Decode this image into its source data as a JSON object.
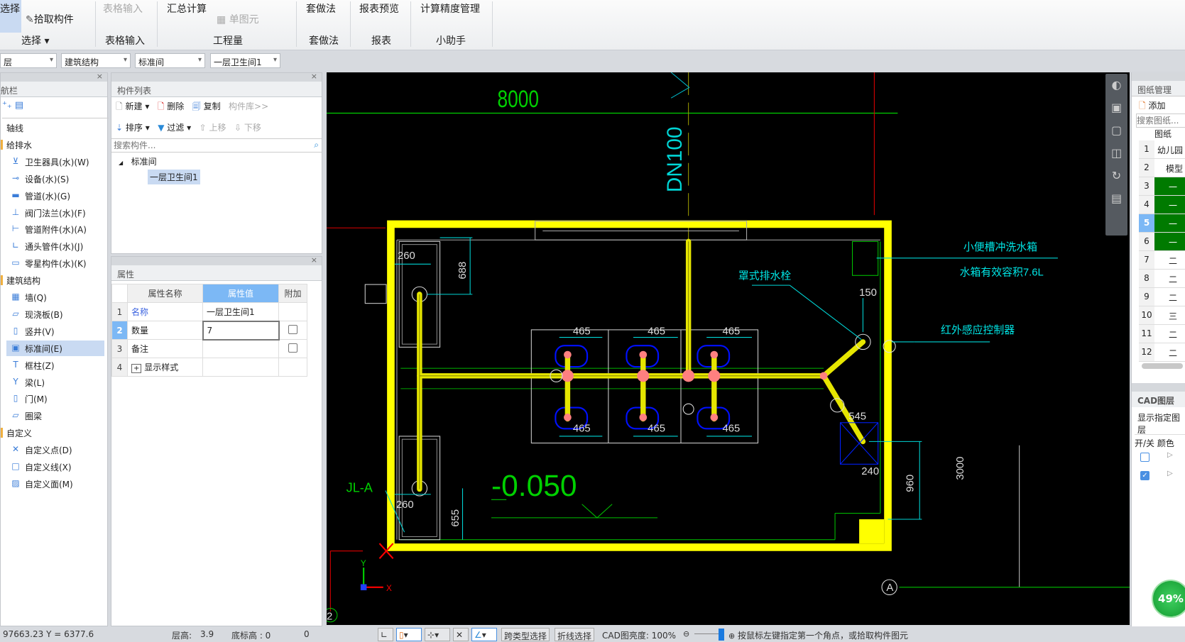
{
  "ribbon": {
    "select_big": "选择",
    "pick": "拾取构件",
    "select_group": "选择 ▾",
    "table_input_btn": "表格输入",
    "table_input_group": "表格输入",
    "summary": "汇总计算",
    "single": "单图元",
    "quantity_group": "工程量",
    "method_btn": "套做法",
    "method_group": "套做法",
    "report_btn": "报表预览",
    "report_group": "报表",
    "precision_btn": "计算精度管理",
    "helper_group": "小助手"
  },
  "toolbar": {
    "floor": "层",
    "major": "建筑结构",
    "type": "标准间",
    "item": "一层卫生间1"
  },
  "nav": {
    "title": "航栏",
    "items": [
      {
        "label": "轴线",
        "group": true
      },
      {
        "label": "给排水",
        "group": true
      },
      {
        "label": "卫生器具(水)(W)",
        "icon": "toilet-icon"
      },
      {
        "label": "设备(水)(S)",
        "icon": "equipment-icon"
      },
      {
        "label": "管道(水)(G)",
        "icon": "pipe-icon"
      },
      {
        "label": "阀门法兰(水)(F)",
        "icon": "valve-icon"
      },
      {
        "label": "管道附件(水)(A)",
        "icon": "pipe-accessory-icon"
      },
      {
        "label": "通头管件(水)(J)",
        "icon": "fitting-icon"
      },
      {
        "label": "零星构件(水)(K)",
        "icon": "misc-icon"
      },
      {
        "label": "建筑结构",
        "group": true
      },
      {
        "label": "墙(Q)",
        "icon": "wall-icon"
      },
      {
        "label": "现浇板(B)",
        "icon": "slab-icon"
      },
      {
        "label": "竖井(V)",
        "icon": "shaft-icon"
      },
      {
        "label": "标准间(E)",
        "icon": "standard-room-icon",
        "selected": true
      },
      {
        "label": "框柱(Z)",
        "icon": "column-icon"
      },
      {
        "label": "梁(L)",
        "icon": "beam-icon"
      },
      {
        "label": "门(M)",
        "icon": "door-icon"
      },
      {
        "label": "圈梁",
        "icon": "ring-beam-icon"
      },
      {
        "label": "自定义",
        "group": true
      },
      {
        "label": "自定义点(D)",
        "icon": "custom-point-icon"
      },
      {
        "label": "自定义线(X)",
        "icon": "custom-line-icon"
      },
      {
        "label": "自定义面(M)",
        "icon": "custom-area-icon"
      }
    ]
  },
  "components": {
    "title": "构件列表",
    "new": "新建",
    "delete": "删除",
    "copy": "复制",
    "library": "构件库>>",
    "sort": "排序",
    "filter": "过滤",
    "up": "上移",
    "down": "下移",
    "search_placeholder": "搜索构件...",
    "tree_parent": "标准间",
    "tree_child": "一层卫生间1"
  },
  "properties": {
    "title": "属性",
    "headers": [
      "属性名称",
      "属性值",
      "附加"
    ],
    "rows": [
      {
        "n": "1",
        "name": "名称",
        "value": "一层卫生间1"
      },
      {
        "n": "2",
        "name": "数量",
        "value": "7"
      },
      {
        "n": "3",
        "name": "备注",
        "value": ""
      },
      {
        "n": "4",
        "name": "显示样式",
        "value": ""
      }
    ]
  },
  "cad": {
    "dim_top": "8000",
    "pipe": "DN100",
    "label_tank": "小便槽冲洗水箱",
    "label_tank_vol": "水箱有效容积7.6L",
    "label_drain": "罩式排水栓",
    "label_sensor": "红外感应控制器",
    "elev": "-0.050",
    "jl": "JL-A",
    "d688": "688",
    "d260a": "260",
    "d260b": "260",
    "d655": "655",
    "d465": [
      "465",
      "465",
      "465",
      "465",
      "465",
      "465"
    ],
    "d150": "150",
    "d545": "545",
    "d240": "240",
    "d960": "960",
    "d3000": "3000",
    "axis_a": "A",
    "axis_2": "2",
    "axis_x": "X",
    "axis_y": "Y"
  },
  "drawings": {
    "title": "图纸管理",
    "add": "添加",
    "search_placeholder": "搜索图纸...",
    "col": "图纸",
    "rows": [
      {
        "n": "1",
        "t": "幼儿园"
      },
      {
        "n": "2",
        "t": "模型"
      },
      {
        "n": "3",
        "t": "一",
        "g": true
      },
      {
        "n": "4",
        "t": "一",
        "g": true
      },
      {
        "n": "5",
        "t": "一",
        "g": true,
        "sel": true
      },
      {
        "n": "6",
        "t": "一",
        "g": true
      },
      {
        "n": "7",
        "t": "二"
      },
      {
        "n": "8",
        "t": "二"
      },
      {
        "n": "9",
        "t": "二"
      },
      {
        "n": "10",
        "t": "三"
      },
      {
        "n": "11",
        "t": "二"
      },
      {
        "n": "12",
        "t": "二"
      }
    ]
  },
  "cad_layers": {
    "title": "CAD图层",
    "show": "显示指定图层",
    "col_onoff": "开/关",
    "col_color": "颜色"
  },
  "progress": {
    "value": "49%",
    "percent": 49
  },
  "status": {
    "coords": "97663.23 Y = 6377.6",
    "floor_h_label": "层高:",
    "floor_h": "3.9",
    "base_label": "底标高 : 0",
    "zero": "0",
    "cross_select": "跨类型选择",
    "poly_select": "折线选择",
    "brightness": "CAD图亮度: 100%",
    "hint": "按鼠标左键指定第一个角点，或拾取构件图元"
  },
  "colors": {
    "cad_bg": "#000000",
    "wall": "#ffff00",
    "pipe": "#e0e000",
    "joint": "#ff8080",
    "cyan": "#00e5e5",
    "green": "#00d000",
    "accent": "#7cb8f5"
  }
}
